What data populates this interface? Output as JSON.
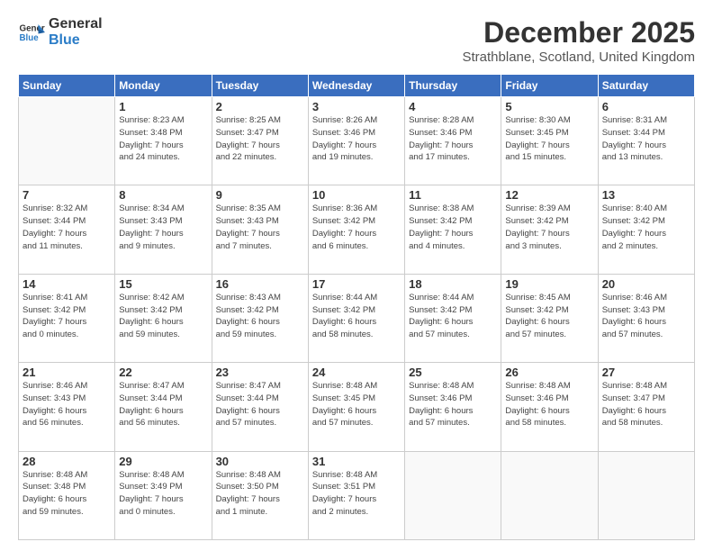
{
  "header": {
    "logo_general": "General",
    "logo_blue": "Blue",
    "month_title": "December 2025",
    "location": "Strathblane, Scotland, United Kingdom"
  },
  "weekdays": [
    "Sunday",
    "Monday",
    "Tuesday",
    "Wednesday",
    "Thursday",
    "Friday",
    "Saturday"
  ],
  "weeks": [
    [
      {
        "day": "",
        "info": ""
      },
      {
        "day": "1",
        "info": "Sunrise: 8:23 AM\nSunset: 3:48 PM\nDaylight: 7 hours\nand 24 minutes."
      },
      {
        "day": "2",
        "info": "Sunrise: 8:25 AM\nSunset: 3:47 PM\nDaylight: 7 hours\nand 22 minutes."
      },
      {
        "day": "3",
        "info": "Sunrise: 8:26 AM\nSunset: 3:46 PM\nDaylight: 7 hours\nand 19 minutes."
      },
      {
        "day": "4",
        "info": "Sunrise: 8:28 AM\nSunset: 3:46 PM\nDaylight: 7 hours\nand 17 minutes."
      },
      {
        "day": "5",
        "info": "Sunrise: 8:30 AM\nSunset: 3:45 PM\nDaylight: 7 hours\nand 15 minutes."
      },
      {
        "day": "6",
        "info": "Sunrise: 8:31 AM\nSunset: 3:44 PM\nDaylight: 7 hours\nand 13 minutes."
      }
    ],
    [
      {
        "day": "7",
        "info": "Sunrise: 8:32 AM\nSunset: 3:44 PM\nDaylight: 7 hours\nand 11 minutes."
      },
      {
        "day": "8",
        "info": "Sunrise: 8:34 AM\nSunset: 3:43 PM\nDaylight: 7 hours\nand 9 minutes."
      },
      {
        "day": "9",
        "info": "Sunrise: 8:35 AM\nSunset: 3:43 PM\nDaylight: 7 hours\nand 7 minutes."
      },
      {
        "day": "10",
        "info": "Sunrise: 8:36 AM\nSunset: 3:42 PM\nDaylight: 7 hours\nand 6 minutes."
      },
      {
        "day": "11",
        "info": "Sunrise: 8:38 AM\nSunset: 3:42 PM\nDaylight: 7 hours\nand 4 minutes."
      },
      {
        "day": "12",
        "info": "Sunrise: 8:39 AM\nSunset: 3:42 PM\nDaylight: 7 hours\nand 3 minutes."
      },
      {
        "day": "13",
        "info": "Sunrise: 8:40 AM\nSunset: 3:42 PM\nDaylight: 7 hours\nand 2 minutes."
      }
    ],
    [
      {
        "day": "14",
        "info": "Sunrise: 8:41 AM\nSunset: 3:42 PM\nDaylight: 7 hours\nand 0 minutes."
      },
      {
        "day": "15",
        "info": "Sunrise: 8:42 AM\nSunset: 3:42 PM\nDaylight: 6 hours\nand 59 minutes."
      },
      {
        "day": "16",
        "info": "Sunrise: 8:43 AM\nSunset: 3:42 PM\nDaylight: 6 hours\nand 59 minutes."
      },
      {
        "day": "17",
        "info": "Sunrise: 8:44 AM\nSunset: 3:42 PM\nDaylight: 6 hours\nand 58 minutes."
      },
      {
        "day": "18",
        "info": "Sunrise: 8:44 AM\nSunset: 3:42 PM\nDaylight: 6 hours\nand 57 minutes."
      },
      {
        "day": "19",
        "info": "Sunrise: 8:45 AM\nSunset: 3:42 PM\nDaylight: 6 hours\nand 57 minutes."
      },
      {
        "day": "20",
        "info": "Sunrise: 8:46 AM\nSunset: 3:43 PM\nDaylight: 6 hours\nand 57 minutes."
      }
    ],
    [
      {
        "day": "21",
        "info": "Sunrise: 8:46 AM\nSunset: 3:43 PM\nDaylight: 6 hours\nand 56 minutes."
      },
      {
        "day": "22",
        "info": "Sunrise: 8:47 AM\nSunset: 3:44 PM\nDaylight: 6 hours\nand 56 minutes."
      },
      {
        "day": "23",
        "info": "Sunrise: 8:47 AM\nSunset: 3:44 PM\nDaylight: 6 hours\nand 57 minutes."
      },
      {
        "day": "24",
        "info": "Sunrise: 8:48 AM\nSunset: 3:45 PM\nDaylight: 6 hours\nand 57 minutes."
      },
      {
        "day": "25",
        "info": "Sunrise: 8:48 AM\nSunset: 3:46 PM\nDaylight: 6 hours\nand 57 minutes."
      },
      {
        "day": "26",
        "info": "Sunrise: 8:48 AM\nSunset: 3:46 PM\nDaylight: 6 hours\nand 58 minutes."
      },
      {
        "day": "27",
        "info": "Sunrise: 8:48 AM\nSunset: 3:47 PM\nDaylight: 6 hours\nand 58 minutes."
      }
    ],
    [
      {
        "day": "28",
        "info": "Sunrise: 8:48 AM\nSunset: 3:48 PM\nDaylight: 6 hours\nand 59 minutes."
      },
      {
        "day": "29",
        "info": "Sunrise: 8:48 AM\nSunset: 3:49 PM\nDaylight: 7 hours\nand 0 minutes."
      },
      {
        "day": "30",
        "info": "Sunrise: 8:48 AM\nSunset: 3:50 PM\nDaylight: 7 hours\nand 1 minute."
      },
      {
        "day": "31",
        "info": "Sunrise: 8:48 AM\nSunset: 3:51 PM\nDaylight: 7 hours\nand 2 minutes."
      },
      {
        "day": "",
        "info": ""
      },
      {
        "day": "",
        "info": ""
      },
      {
        "day": "",
        "info": ""
      }
    ]
  ]
}
